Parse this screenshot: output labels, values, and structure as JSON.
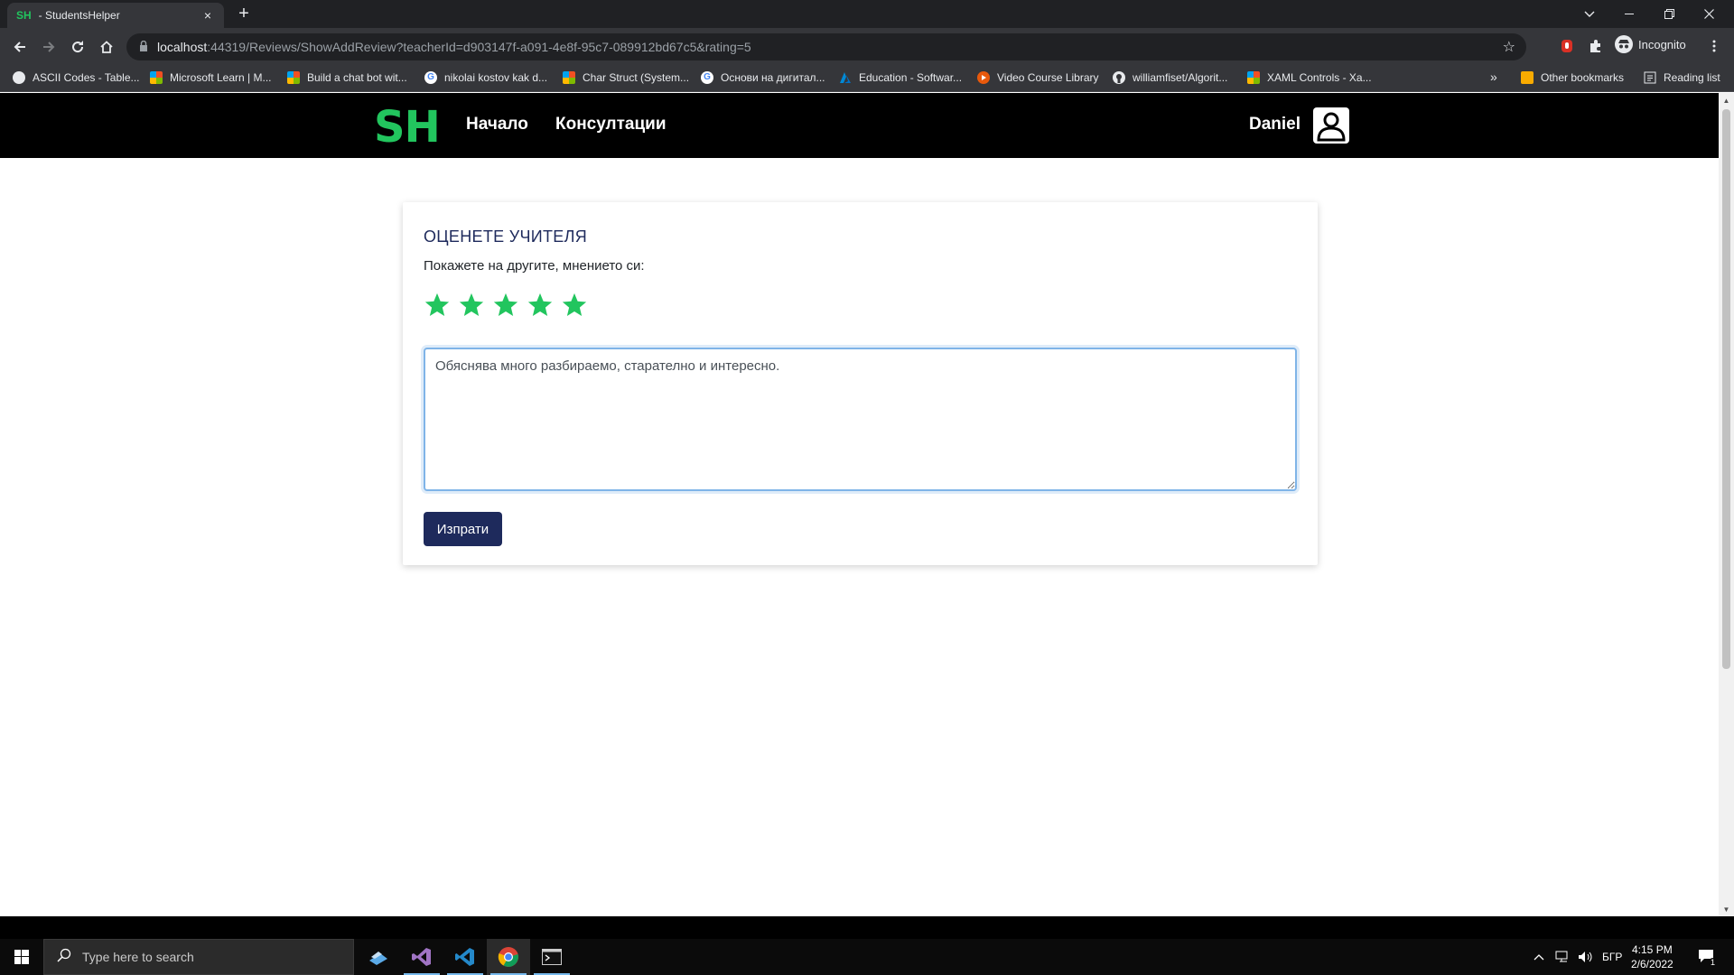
{
  "browser": {
    "tab_favicon": "SH",
    "tab_title": "- StudentsHelper",
    "tab_close": "×",
    "new_tab": "+",
    "url_host": "localhost",
    "url_rest": ":44319/Reviews/ShowAddReview?teacherId=d903147f-a091-4e8f-95c7-089912bd67c5&rating=5",
    "profile_label": "Incognito",
    "bookmarks": [
      {
        "label": "ASCII Codes - Table...",
        "icon": "globe-icon"
      },
      {
        "label": "Microsoft Learn | M...",
        "icon": "microsoft-icon"
      },
      {
        "label": "Build a chat bot wit...",
        "icon": "microsoft-icon"
      },
      {
        "label": "nikolai kostov kak d...",
        "icon": "google-icon"
      },
      {
        "label": "Char Struct (System...",
        "icon": "microsoft-icon"
      },
      {
        "label": "Основи на дигитал...",
        "icon": "google-icon"
      },
      {
        "label": "Education - Softwar...",
        "icon": "azure-icon"
      },
      {
        "label": "Video Course Library",
        "icon": "play-icon"
      },
      {
        "label": "williamfiset/Algorit...",
        "icon": "github-icon"
      },
      {
        "label": "XAML Controls - Xa...",
        "icon": "microsoft-icon"
      }
    ],
    "bookmarks_overflow": "»",
    "other_bookmarks": "Other bookmarks",
    "reading_list": "Reading list"
  },
  "site": {
    "logo": "SH",
    "nav": {
      "home": "Начало",
      "consultations": "Консултации"
    },
    "user_name": "Daniel"
  },
  "review": {
    "title": "ОЦЕНЕТЕ УЧИТЕЛЯ",
    "subtitle": "Покажете на другите, мнението си:",
    "rating": 5,
    "max_rating": 5,
    "star_color": "#22c55e",
    "text": "Обяснява много разбираемо, старателно и интересно.",
    "submit_label": "Изпрати"
  },
  "taskbar": {
    "search_placeholder": "Type here to search",
    "language": "БГР",
    "time": "4:15 PM",
    "date": "2/6/2022",
    "notification_count": "1"
  },
  "colors": {
    "accent_green": "#22c55e",
    "navy": "#1e2a5c"
  }
}
